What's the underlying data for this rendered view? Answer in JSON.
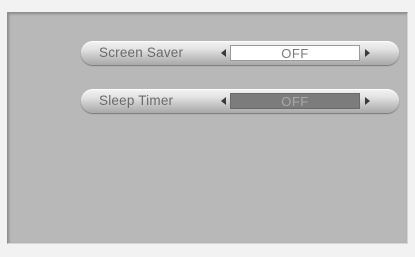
{
  "menu": {
    "items": [
      {
        "label": "Screen Saver",
        "value": "OFF",
        "selected": true
      },
      {
        "label": "Sleep Timer",
        "value": "OFF",
        "selected": false
      }
    ]
  },
  "colors": {
    "background": "#f2f2f2",
    "panel": "#b8b8b8",
    "selected_value_bg": "#ffffff",
    "unselected_value_bg": "#7c7c7c"
  },
  "icons": {
    "left_arrow": "arrow-left-icon",
    "right_arrow": "arrow-right-icon"
  }
}
